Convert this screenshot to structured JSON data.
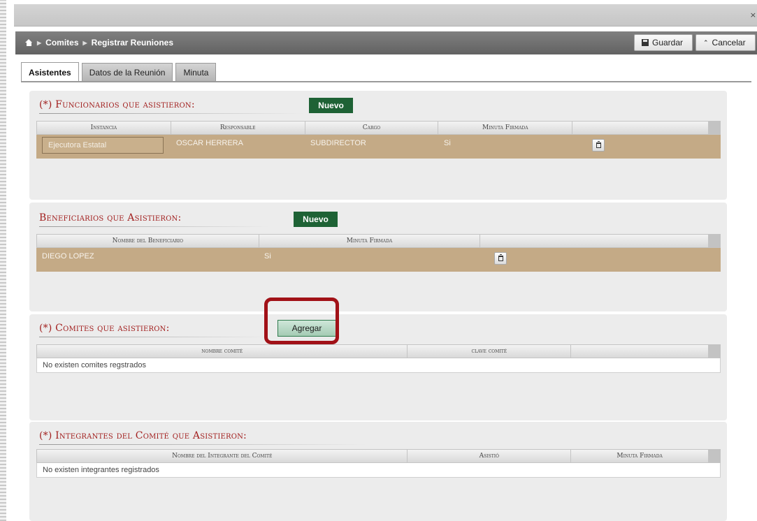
{
  "window": {
    "close_glyph": "×"
  },
  "breadcrumb": {
    "items": [
      "Comites",
      "Registrar Reuniones"
    ]
  },
  "toolbar": {
    "save_label": "Guardar",
    "cancel_label": "Cancelar"
  },
  "tabs": [
    {
      "label": "Asistentes",
      "active": true
    },
    {
      "label": "Datos de la Reunión",
      "active": false
    },
    {
      "label": "Minuta",
      "active": false
    }
  ],
  "funcionarios": {
    "title": "(*) Funcionarios que asistieron:",
    "new_label": "Nuevo",
    "columns": [
      "Instancia",
      "Responsable",
      "Cargo",
      "Minuta Firmada",
      ""
    ],
    "rows": [
      {
        "instancia": "Ejecutora Estatal",
        "responsable": "OSCAR HERRERA",
        "cargo": "SUBDIRECTOR",
        "minuta": "Si"
      }
    ]
  },
  "beneficiarios": {
    "title": "Beneficiarios que Asistieron:",
    "new_label": "Nuevo",
    "columns": [
      "Nombre del Beneficiario",
      "Minuta Firmada",
      ""
    ],
    "rows": [
      {
        "nombre": "DIEGO LOPEZ",
        "minuta": "Si"
      }
    ]
  },
  "comites": {
    "title": "(*) Comites que asistieron:",
    "add_label": "Agregar",
    "columns": [
      "nombre comité",
      "clave comité",
      ""
    ],
    "empty_text": "No existen comites regstrados"
  },
  "integrantes": {
    "title": "(*) Integrantes del Comité que Asistieron:",
    "columns": [
      "Nombre del Integrante del Comité",
      "Asistió",
      "Minuta Firmada"
    ],
    "empty_text": "No existen integrantes registrados"
  },
  "colors": {
    "accent_red": "#a2201f",
    "brand_green": "#1e6235",
    "row_tan": "#c4aa86",
    "highlight": "#a11117"
  }
}
